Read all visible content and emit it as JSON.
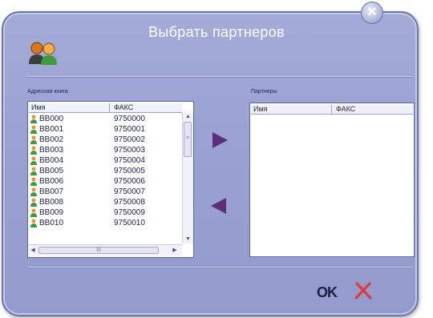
{
  "window": {
    "title": "Выбрать партнеров",
    "close_glyph": "✕"
  },
  "address_book": {
    "label": "Адресная книга",
    "columns": [
      "Имя",
      "ФАКС"
    ],
    "rows": [
      {
        "name": "BB000",
        "fax": "9750000"
      },
      {
        "name": "BB001",
        "fax": "9750001"
      },
      {
        "name": "BB002",
        "fax": "9750002"
      },
      {
        "name": "BB003",
        "fax": "9750003"
      },
      {
        "name": "BB004",
        "fax": "9750004"
      },
      {
        "name": "BB005",
        "fax": "9750005"
      },
      {
        "name": "BB006",
        "fax": "9750006"
      },
      {
        "name": "BB007",
        "fax": "9750007"
      },
      {
        "name": "BB008",
        "fax": "9750008"
      },
      {
        "name": "BB009",
        "fax": "9750009"
      },
      {
        "name": "BB010",
        "fax": "9750010"
      }
    ],
    "scroll_thumb_glyph": "≡",
    "hscroll_thumb_glyph": "III"
  },
  "partners": {
    "label": "Партнеры",
    "columns": [
      "Имя",
      "ФАКС"
    ],
    "rows": []
  },
  "buttons": {
    "ok_label": "OK",
    "add_icon": "triangle-right-icon",
    "remove_icon": "triangle-left-icon",
    "cancel_icon": "red-x-icon"
  },
  "colors": {
    "window_bg": "#9aa2d2",
    "arrow": "#5a2f7a",
    "cancel": "#e03a3a",
    "contact_icon": "#e8951a"
  }
}
